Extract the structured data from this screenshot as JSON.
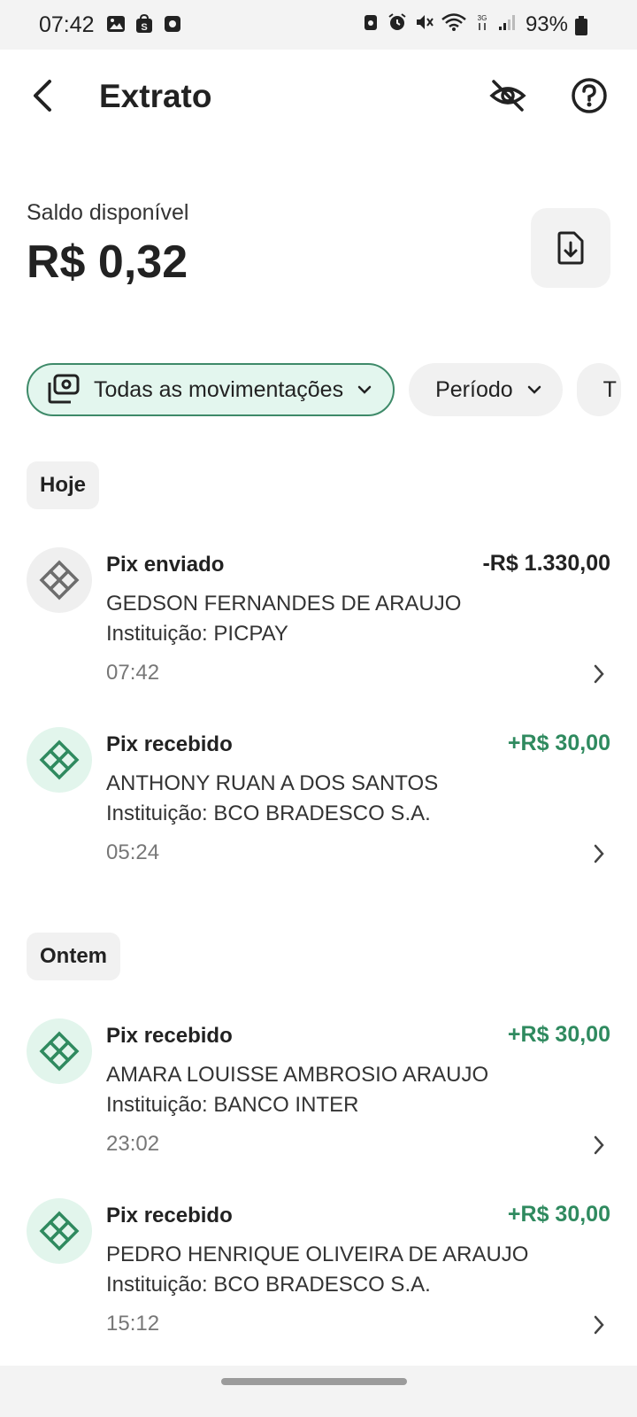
{
  "status_bar": {
    "time": "07:42",
    "battery": "93%",
    "icons": [
      "image-icon",
      "shop-icon",
      "record-icon",
      "recycle-icon",
      "alarm-icon",
      "mute-icon",
      "wifi-icon",
      "3g-icon",
      "signal-icon",
      "battery-icon"
    ]
  },
  "header": {
    "title": "Extrato"
  },
  "balance": {
    "label": "Saldo disponível",
    "value": "R$ 0,32"
  },
  "filters": {
    "all_label": "Todas as movimentações",
    "period_label": "Período",
    "partial_label": "T"
  },
  "groups": [
    {
      "label": "Hoje",
      "transactions": [
        {
          "type": "Pix enviado",
          "amount": "-R$ 1.330,00",
          "name": "GEDSON FERNANDES DE ARAUJO",
          "institution": "Instituição: PICPAY",
          "time": "07:42"
        },
        {
          "type": "Pix recebido",
          "amount": "+R$ 30,00",
          "name": "ANTHONY RUAN A DOS SANTOS",
          "institution": "Instituição: BCO BRADESCO S.A.",
          "time": "05:24"
        }
      ]
    },
    {
      "label": "Ontem",
      "transactions": [
        {
          "type": "Pix recebido",
          "amount": "+R$ 30,00",
          "name": "AMARA LOUISSE AMBROSIO ARAUJO",
          "institution": "Instituição: BANCO INTER",
          "time": "23:02"
        },
        {
          "type": "Pix recebido",
          "amount": "+R$ 30,00",
          "name": "PEDRO HENRIQUE OLIVEIRA DE ARAUJO",
          "institution": "Instituição: BCO BRADESCO S.A.",
          "time": "15:12"
        }
      ]
    }
  ],
  "colors": {
    "accent_green": "#2f8a5f",
    "chip_active_bg": "#e3f6ee",
    "chip_active_border": "#3e8a69"
  }
}
